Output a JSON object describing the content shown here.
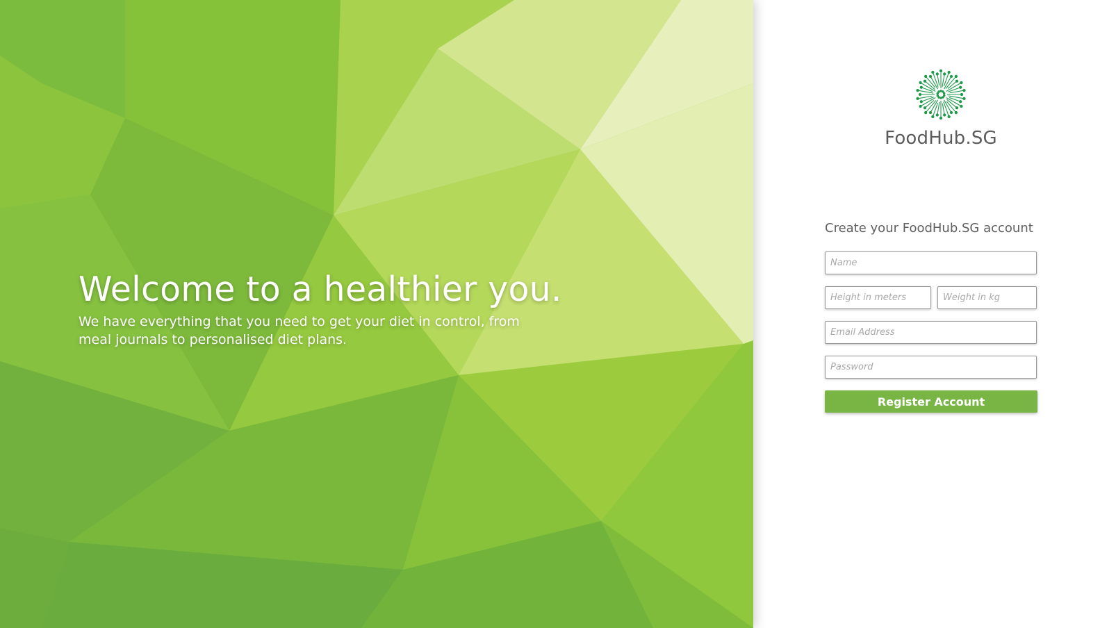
{
  "hero": {
    "headline": "Welcome to a healthier you.",
    "subtext": "We have everything that you need to get your diet in control, from meal journals to personalised diet plans."
  },
  "brand": {
    "name": "FoodHub.SG",
    "logo_icon": "dandelion-burst-icon",
    "accent_color": "#79b545",
    "logo_color": "#1f9a4a"
  },
  "form": {
    "title": "Create your FoodHub.SG account",
    "name_placeholder": "Name",
    "height_placeholder": "Height in meters",
    "weight_placeholder": "Weight in kg",
    "email_placeholder": "Email Address",
    "password_placeholder": "Password",
    "submit_label": "Register Account"
  }
}
